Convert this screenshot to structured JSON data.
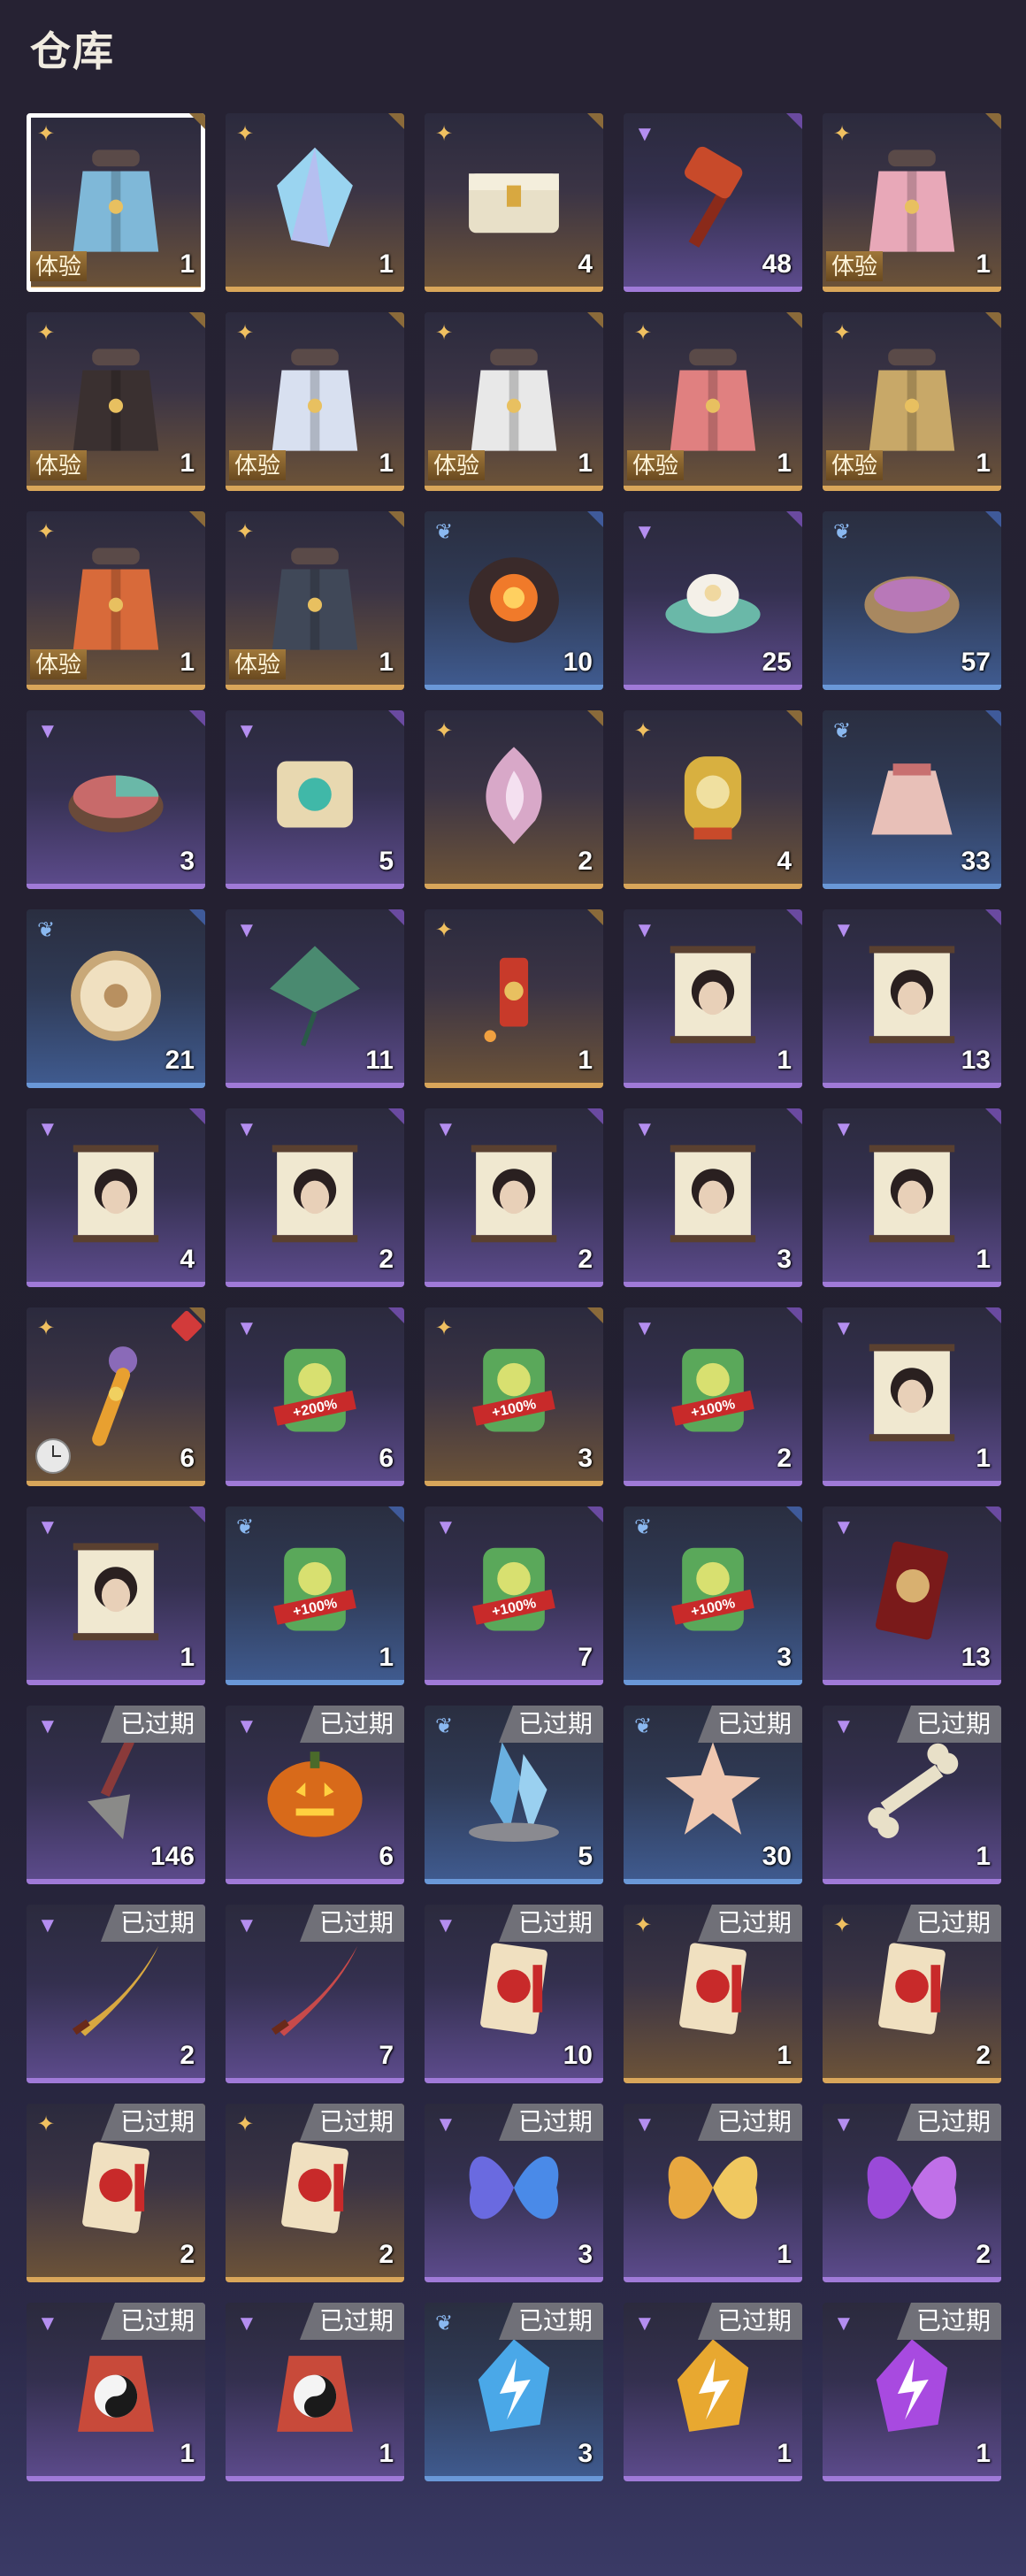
{
  "page_title": "仓库",
  "badges": {
    "trial": "体验",
    "expired": "已过期"
  },
  "items": [
    {
      "rarity": "gold",
      "icon": "costume-blue-robe-icon",
      "count": "1",
      "trial": true,
      "selected": true
    },
    {
      "rarity": "gold",
      "icon": "crystal-icon",
      "count": "1"
    },
    {
      "rarity": "gold",
      "icon": "white-chest-icon",
      "count": "4"
    },
    {
      "rarity": "purple",
      "icon": "hammer-icon",
      "count": "48"
    },
    {
      "rarity": "gold",
      "icon": "costume-pink-dress-icon",
      "count": "1",
      "trial": true
    },
    {
      "rarity": "gold",
      "icon": "costume-black-gold-icon",
      "count": "1",
      "trial": true
    },
    {
      "rarity": "gold",
      "icon": "costume-white-blue-icon",
      "count": "1",
      "trial": true
    },
    {
      "rarity": "gold",
      "icon": "costume-white-coat-icon",
      "count": "1",
      "trial": true
    },
    {
      "rarity": "gold",
      "icon": "costume-red-white-icon",
      "count": "1",
      "trial": true
    },
    {
      "rarity": "gold",
      "icon": "costume-gold-black-icon",
      "count": "1",
      "trial": true
    },
    {
      "rarity": "gold",
      "icon": "costume-red-gold-icon",
      "count": "1",
      "trial": true
    },
    {
      "rarity": "gold",
      "icon": "costume-dark-armor-icon",
      "count": "1",
      "trial": true
    },
    {
      "rarity": "blue",
      "icon": "fire-shell-icon",
      "count": "10"
    },
    {
      "rarity": "purple",
      "icon": "lotus-icon",
      "count": "25"
    },
    {
      "rarity": "blue",
      "icon": "purple-powder-bowl-icon",
      "count": "57"
    },
    {
      "rarity": "purple",
      "icon": "color-box-icon",
      "count": "3"
    },
    {
      "rarity": "purple",
      "icon": "puzzle-piece-icon",
      "count": "5"
    },
    {
      "rarity": "gold",
      "icon": "flame-ornament-icon",
      "count": "2"
    },
    {
      "rarity": "gold",
      "icon": "gold-token-icon",
      "count": "4"
    },
    {
      "rarity": "blue",
      "icon": "pouch-icon",
      "count": "33"
    },
    {
      "rarity": "blue",
      "icon": "drum-icon",
      "count": "21"
    },
    {
      "rarity": "purple",
      "icon": "kite-icon",
      "count": "11"
    },
    {
      "rarity": "gold",
      "icon": "firework-icon",
      "count": "1"
    },
    {
      "rarity": "purple",
      "icon": "portrait-scroll-icon",
      "count": "1"
    },
    {
      "rarity": "purple",
      "icon": "portrait-scroll-icon",
      "count": "13"
    },
    {
      "rarity": "purple",
      "icon": "portrait-scroll-icon",
      "count": "4"
    },
    {
      "rarity": "purple",
      "icon": "portrait-scroll-icon",
      "count": "2"
    },
    {
      "rarity": "purple",
      "icon": "portrait-scroll-icon",
      "count": "2"
    },
    {
      "rarity": "purple",
      "icon": "portrait-scroll-icon",
      "count": "3"
    },
    {
      "rarity": "purple",
      "icon": "portrait-scroll-icon",
      "count": "1"
    },
    {
      "rarity": "gold",
      "icon": "gourd-key-icon",
      "count": "6",
      "clock": true,
      "redbadge": true
    },
    {
      "rarity": "purple",
      "icon": "boost-token-icon",
      "count": "6",
      "label": "+200%"
    },
    {
      "rarity": "gold",
      "icon": "boost-token-icon",
      "count": "3",
      "label": "+100%"
    },
    {
      "rarity": "purple",
      "icon": "boost-token-icon",
      "count": "2",
      "label": "+100%"
    },
    {
      "rarity": "purple",
      "icon": "portrait-scroll-icon",
      "count": "1"
    },
    {
      "rarity": "purple",
      "icon": "portrait-scroll-icon",
      "count": "1"
    },
    {
      "rarity": "blue",
      "icon": "boost-token-icon",
      "count": "1",
      "label": "+100%"
    },
    {
      "rarity": "purple",
      "icon": "boost-token-icon",
      "count": "7",
      "label": "+100%"
    },
    {
      "rarity": "blue",
      "icon": "boost-token-icon",
      "count": "3",
      "label": "+100%"
    },
    {
      "rarity": "purple",
      "icon": "red-card-icon",
      "count": "13"
    },
    {
      "rarity": "purple",
      "icon": "shovel-icon",
      "count": "146",
      "expired": true
    },
    {
      "rarity": "purple",
      "icon": "pumpkin-icon",
      "count": "6",
      "expired": true
    },
    {
      "rarity": "blue",
      "icon": "ice-crystal-icon",
      "count": "5",
      "expired": true
    },
    {
      "rarity": "blue",
      "icon": "starfish-icon",
      "count": "30",
      "expired": true
    },
    {
      "rarity": "purple",
      "icon": "bone-icon",
      "count": "1",
      "expired": true
    },
    {
      "rarity": "purple",
      "icon": "gold-sword-icon",
      "count": "2",
      "expired": true
    },
    {
      "rarity": "purple",
      "icon": "red-sword-icon",
      "count": "7",
      "expired": true
    },
    {
      "rarity": "purple",
      "icon": "talisman-card-icon",
      "count": "10",
      "expired": true
    },
    {
      "rarity": "gold",
      "icon": "talisman-card-icon",
      "count": "1",
      "expired": true
    },
    {
      "rarity": "gold",
      "icon": "talisman-card-icon",
      "count": "2",
      "expired": true
    },
    {
      "rarity": "gold",
      "icon": "talisman-card-icon",
      "count": "2",
      "expired": true
    },
    {
      "rarity": "gold",
      "icon": "talisman-card-icon",
      "count": "2",
      "expired": true
    },
    {
      "rarity": "purple",
      "icon": "blue-butterfly-icon",
      "count": "3",
      "expired": true
    },
    {
      "rarity": "purple",
      "icon": "yellow-butterfly-icon",
      "count": "1",
      "expired": true
    },
    {
      "rarity": "purple",
      "icon": "purple-butterfly-icon",
      "count": "2",
      "expired": true
    },
    {
      "rarity": "purple",
      "icon": "yin-yang-pouch-icon",
      "count": "1",
      "expired": true
    },
    {
      "rarity": "purple",
      "icon": "yin-yang-pouch-icon",
      "count": "1",
      "expired": true
    },
    {
      "rarity": "blue",
      "icon": "lightning-stone-blue-icon",
      "count": "3",
      "expired": true
    },
    {
      "rarity": "purple",
      "icon": "lightning-stone-gold-icon",
      "count": "1",
      "expired": true
    },
    {
      "rarity": "purple",
      "icon": "lightning-stone-purple-icon",
      "count": "1",
      "expired": true
    }
  ]
}
